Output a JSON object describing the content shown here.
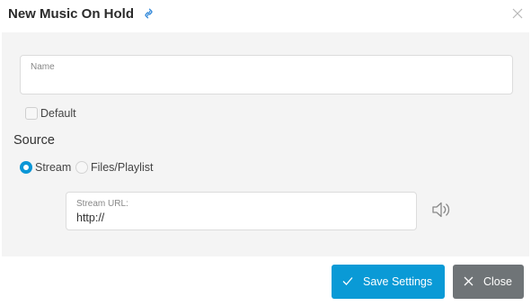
{
  "dialog": {
    "title": "New Music On Hold"
  },
  "form": {
    "name_label": "Name",
    "name_value": "",
    "default_label": "Default",
    "default_checked": false,
    "source_heading": "Source",
    "source_options": [
      {
        "label": "Stream",
        "selected": true
      },
      {
        "label": "Files/Playlist",
        "selected": false
      }
    ],
    "stream_url_label": "Stream URL:",
    "stream_url_value": "http://"
  },
  "footer": {
    "save_label": "Save Settings",
    "close_label": "Close"
  },
  "colors": {
    "accent": "#0a96d6",
    "close_button": "#6f7477",
    "link": "#3a8ddb"
  },
  "icons": [
    "link-icon",
    "close-icon",
    "speaker-icon",
    "checkmark-icon",
    "x-icon"
  ]
}
